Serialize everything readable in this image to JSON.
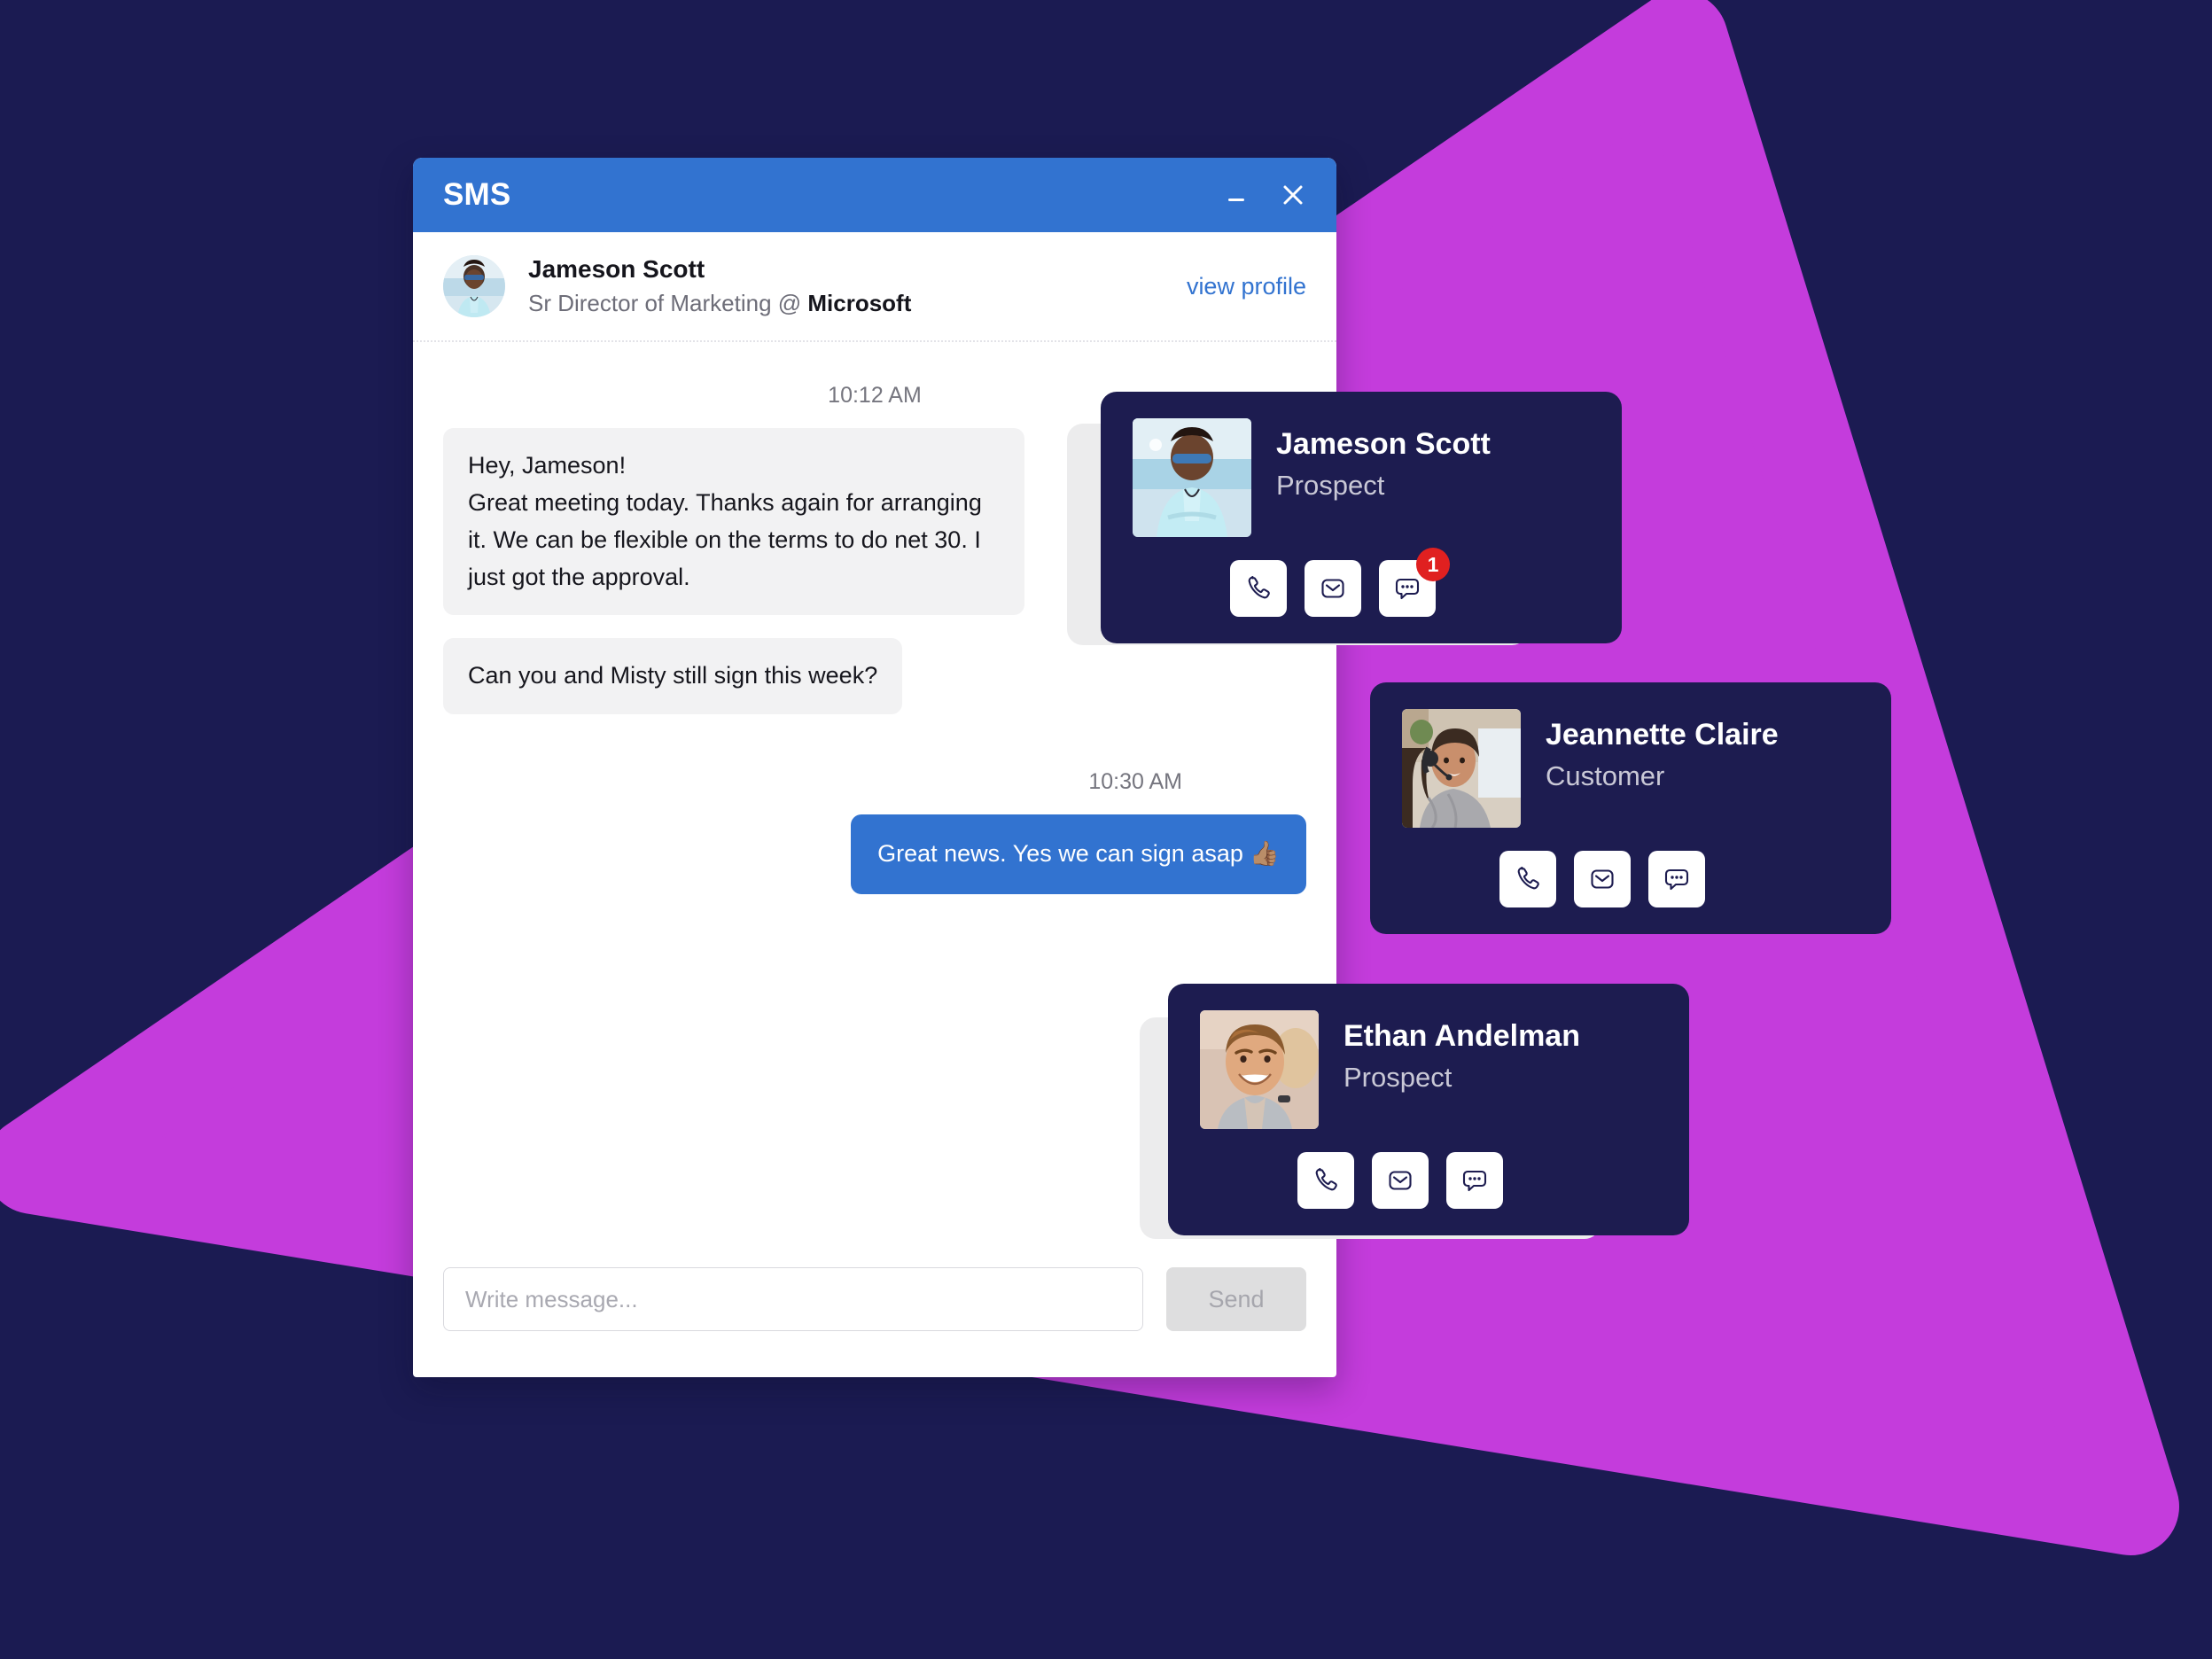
{
  "theme": {
    "background": "#1b1b52",
    "accent_magenta": "#c43cdc",
    "header_blue": "#3273d0",
    "card_navy": "#1d1c50",
    "badge_red": "#e02020"
  },
  "window": {
    "title": "SMS",
    "minimize_icon": "minimize-icon",
    "close_icon": "close-icon"
  },
  "contact_header": {
    "avatar_icon": "avatar-jameson",
    "name": "Jameson Scott",
    "role_prefix": "Sr Director of Marketing @ ",
    "company": "Microsoft",
    "view_profile_label": "view profile"
  },
  "thread": [
    {
      "type": "timestamp",
      "align": "left",
      "text": "10:12 AM"
    },
    {
      "type": "message",
      "direction": "in",
      "text": "Hey, Jameson!\nGreat meeting today. Thanks again for arranging it.  We can be flexible on the terms to do net 30. I just got the approval."
    },
    {
      "type": "message",
      "direction": "in",
      "text": "Can you and Misty still sign this week?"
    },
    {
      "type": "timestamp",
      "align": "right",
      "text": "10:30 AM"
    },
    {
      "type": "message",
      "direction": "out",
      "text": "Great news. Yes we can sign asap 👍🏽"
    }
  ],
  "composer": {
    "placeholder": "Write message...",
    "value": "",
    "send_label": "Send"
  },
  "contact_cards": [
    {
      "id": "jameson",
      "photo_icon": "photo-jameson",
      "name": "Jameson Scott",
      "role": "Prospect",
      "actions": [
        {
          "icon": "phone-icon",
          "badge": null
        },
        {
          "icon": "envelope-icon",
          "badge": null
        },
        {
          "icon": "chat-bubble-icon",
          "badge": "1"
        }
      ]
    },
    {
      "id": "jeannette",
      "photo_icon": "photo-jeannette",
      "name": "Jeannette Claire",
      "role": "Customer",
      "actions": [
        {
          "icon": "phone-icon",
          "badge": null
        },
        {
          "icon": "envelope-icon",
          "badge": null
        },
        {
          "icon": "chat-bubble-icon",
          "badge": null
        }
      ]
    },
    {
      "id": "ethan",
      "photo_icon": "photo-ethan",
      "name": "Ethan Andelman",
      "role": "Prospect",
      "actions": [
        {
          "icon": "phone-icon",
          "badge": null
        },
        {
          "icon": "envelope-icon",
          "badge": null
        },
        {
          "icon": "chat-bubble-icon",
          "badge": null
        }
      ]
    }
  ]
}
